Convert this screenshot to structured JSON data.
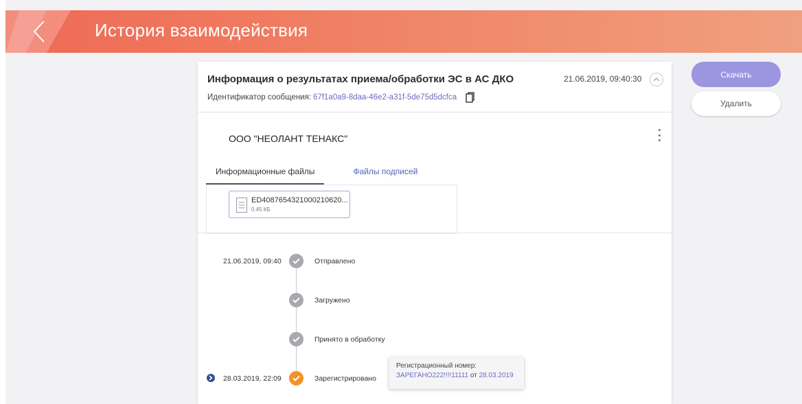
{
  "header": {
    "title": "История взаимодействия",
    "back_icon": "chevron-left-icon"
  },
  "card": {
    "title": "Информация о результатах приема/обработки ЭС в АС ДКО",
    "date": "21.06.2019, 09:40:30",
    "message_id_label": "Идентификатор сообщения:",
    "message_id_value": "67f1a0a9-8daa-46e2-a31f-5de75d5dcfca",
    "organization": "ООО \"НЕОЛАНТ ТЕНАКС\"",
    "tabs": [
      {
        "label": "Информационные файлы",
        "active": true
      },
      {
        "label": "Файлы подписей",
        "active": false
      }
    ],
    "files": [
      {
        "name": "ED4087654321000210620...",
        "size": "0.45 КБ"
      }
    ]
  },
  "timeline": [
    {
      "date": "21.06.2019, 09:40",
      "label": "Отправлено",
      "status": "done"
    },
    {
      "date": "",
      "label": "Загружено",
      "status": "done"
    },
    {
      "date": "",
      "label": "Принято в обработку",
      "status": "done"
    },
    {
      "date": "28.03.2019, 22:09",
      "label": "Зарегистрировано",
      "status": "current"
    }
  ],
  "registration_popup": {
    "label": "Регистрационный номер:",
    "number": "ЗАРЕГАНО222!!!!11111",
    "from_word": "от",
    "date": "28.03.2019"
  },
  "actions": {
    "download_label": "Скачать",
    "delete_label": "Удалить"
  },
  "colors": {
    "header_start": "#ee6a56",
    "header_end": "#f0a07f",
    "primary_button": "#9c95e0",
    "link": "#6b6bbf",
    "status_done": "#a9a9ad",
    "status_current": "#f39224"
  }
}
